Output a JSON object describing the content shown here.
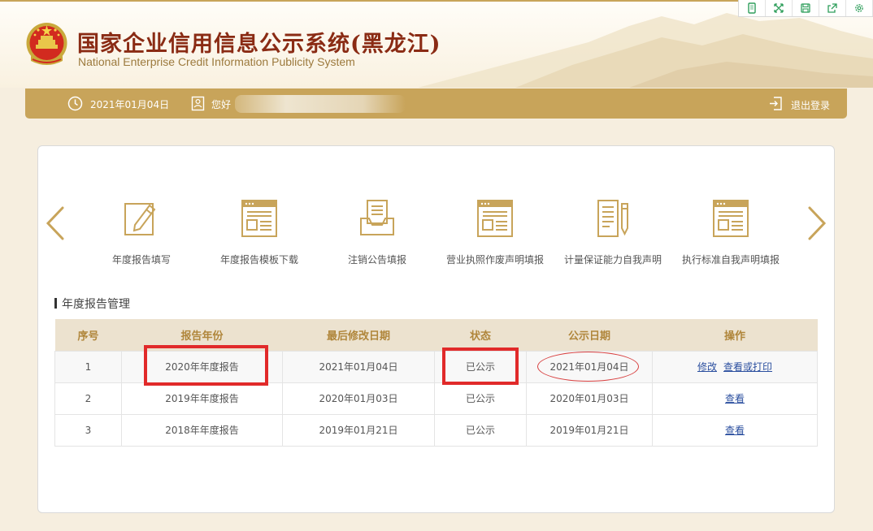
{
  "header": {
    "title_cn": "国家企业信用信息公示系统(黑龙江)",
    "title_en": "National Enterprise Credit Information Publicity System"
  },
  "toolbar": {
    "icons": [
      "phone-frame-icon",
      "expand-icon",
      "save-icon",
      "share-icon",
      "settings-icon"
    ]
  },
  "userbar": {
    "date": "2021年01月04日",
    "greeting": "您好",
    "logout_label": "退出登录"
  },
  "functions": [
    {
      "label": "年度报告填写",
      "icon": "edit-form-icon"
    },
    {
      "label": "年度报告模板下载",
      "icon": "template-window-icon"
    },
    {
      "label": "注销公告填报",
      "icon": "inbox-document-icon"
    },
    {
      "label": "营业执照作废声明填报",
      "icon": "template-window-icon"
    },
    {
      "label": "计量保证能力自我声明",
      "icon": "document-pen-icon"
    },
    {
      "label": "执行标准自我声明填报",
      "icon": "template-window-icon"
    }
  ],
  "section": {
    "title": "年度报告管理"
  },
  "table": {
    "headers": [
      "序号",
      "报告年份",
      "最后修改日期",
      "状态",
      "公示日期",
      "操作"
    ],
    "rows": [
      {
        "no": "1",
        "year": "2020年年度报告",
        "modified": "2021年01月04日",
        "status": "已公示",
        "published": "2021年01月04日",
        "actions": [
          "修改",
          "查看或打印"
        ]
      },
      {
        "no": "2",
        "year": "2019年年度报告",
        "modified": "2020年01月03日",
        "status": "已公示",
        "published": "2020年01月03日",
        "actions": [
          "查看"
        ]
      },
      {
        "no": "3",
        "year": "2018年年度报告",
        "modified": "2019年01月21日",
        "status": "已公示",
        "published": "2019年01月21日",
        "actions": [
          "查看"
        ]
      }
    ]
  },
  "colors": {
    "gold": "#c8a45a",
    "title_red": "#8a2b14",
    "header_cell_bg": "#ece2cf",
    "link_blue": "#2b4f9f",
    "annotation_red": "#e12a2a"
  }
}
